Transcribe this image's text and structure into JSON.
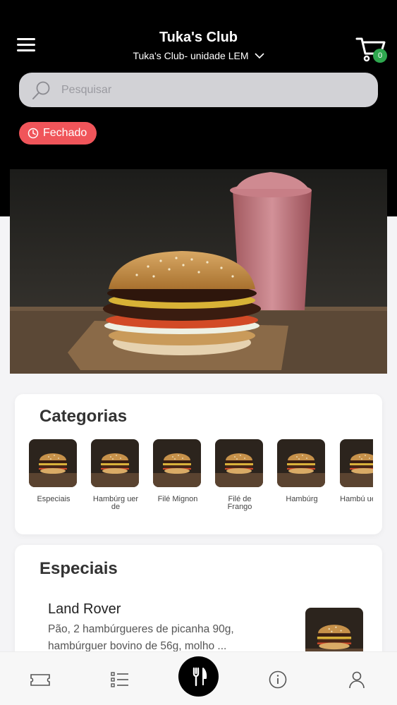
{
  "header": {
    "title": "Tuka's Club",
    "unit": "Tuka's Club- unidade LEM",
    "cart_count": "0"
  },
  "search": {
    "placeholder": "Pesquisar"
  },
  "status": {
    "label": "Fechado",
    "color": "#f0555a"
  },
  "categories": {
    "title": "Categorias",
    "items": [
      {
        "label": "Especiais"
      },
      {
        "label": "Hambúrg uer de"
      },
      {
        "label": "Filé Mignon"
      },
      {
        "label": "Filé de Frango"
      },
      {
        "label": "Hambúrg"
      },
      {
        "label": "Hambú uer de"
      }
    ]
  },
  "specials": {
    "title": "Especiais",
    "items": [
      {
        "name": "Land Rover",
        "description": "Pão, 2 hambúrgueres de picanha 90g, hambúrguer bovino de 56g, molho ..."
      }
    ]
  },
  "bottom_nav": [
    {
      "icon": "ticket-icon"
    },
    {
      "icon": "list-icon"
    },
    {
      "icon": "fork-knife-icon"
    },
    {
      "icon": "info-icon"
    },
    {
      "icon": "user-icon"
    }
  ],
  "colors": {
    "accent_green": "#2fa84f",
    "header_bg": "#000000"
  }
}
